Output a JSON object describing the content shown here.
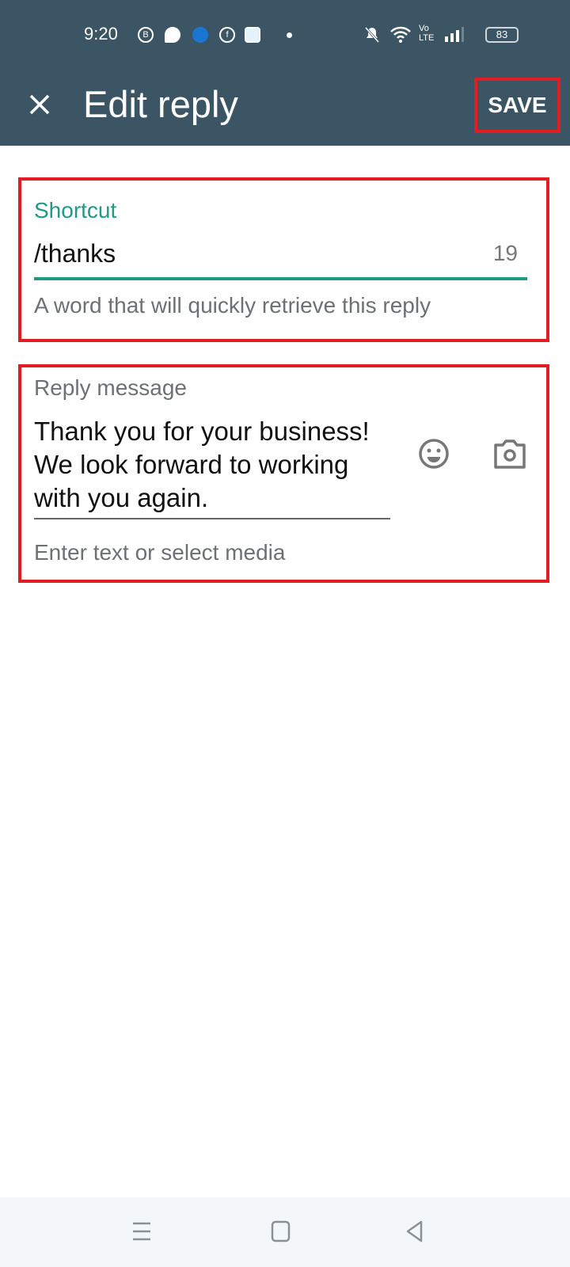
{
  "status_bar": {
    "time": "9:20",
    "notification_icons": [
      "whatsapp-business-icon",
      "chat-bubble-icon",
      "edge-browser-icon",
      "facebook-icon",
      "files-app-icon",
      "more-dot-icon"
    ],
    "system_icons": [
      "silent-bell-icon",
      "wifi-icon",
      "volte-icon",
      "signal-icon"
    ],
    "volte_label": "Vo LTE",
    "battery_level": "83"
  },
  "app_bar": {
    "title": "Edit reply",
    "close_icon": "close-icon",
    "save_label": "SAVE"
  },
  "shortcut_field": {
    "label": "Shortcut",
    "value": "/thanks",
    "remaining_chars": "19",
    "helper": "A word that will quickly retrieve this reply",
    "accent_color": "#1f9a84"
  },
  "reply_field": {
    "label": "Reply message",
    "value": "Thank you for your business! We look forward to working with you again.",
    "helper": "Enter text or select media",
    "emoji_icon": "emoji-icon",
    "camera_icon": "camera-icon"
  },
  "nav_bar": {
    "buttons": [
      "menu-icon",
      "home-icon",
      "back-icon"
    ]
  },
  "highlight_color": "#e31b23"
}
